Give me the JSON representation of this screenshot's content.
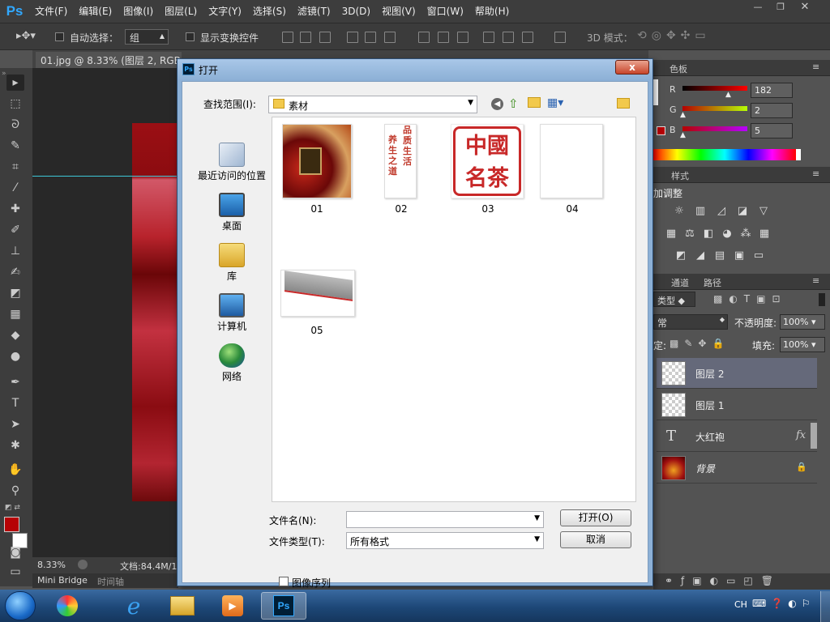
{
  "app": {
    "logo": "Ps"
  },
  "menu": [
    "文件(F)",
    "编辑(E)",
    "图像(I)",
    "图层(L)",
    "文字(Y)",
    "选择(S)",
    "滤镜(T)",
    "3D(D)",
    "视图(V)",
    "窗口(W)",
    "帮助(H)"
  ],
  "options": {
    "auto_select_label": "自动选择：",
    "auto_select_value": "组",
    "show_transform_label": "显示变换控件",
    "mode_3d_label": "3D 模式："
  },
  "document": {
    "tab_title": "01.jpg @ 8.33% (图层 2, RGB/8) *",
    "zoom": "8.33%",
    "doc_size": "文档:84.4M/1"
  },
  "bottom_tabs": [
    "Mini Bridge",
    "时间轴"
  ],
  "color_panel": {
    "tabs": [
      "色板"
    ],
    "r_label": "R",
    "g_label": "G",
    "b_label": "B",
    "r": "182",
    "g": "2",
    "b": "5",
    "fg_color": "#b60205",
    "bg_color": "#ffffff"
  },
  "adjust_panel": {
    "tabs": [
      "样式"
    ],
    "title": "加调整"
  },
  "layers_panel": {
    "tabs": [
      "通道",
      "路径"
    ],
    "kind_label": "类型",
    "blend_mode": "常",
    "opacity_label": "不透明度:",
    "opacity": "100%",
    "fill_label": "填充:",
    "fill": "100%",
    "lock_label": "定:"
  },
  "layers": [
    {
      "name": "图层 2",
      "selected": true
    },
    {
      "name": "图层 1",
      "selected": false
    },
    {
      "name": "大红袍",
      "type": "text",
      "fx": "fx"
    },
    {
      "name": "背景",
      "locked": true
    }
  ],
  "dialog": {
    "title": "打开",
    "title_icon": "Ps",
    "close": "x",
    "look_in_label": "查找范围(I):",
    "look_in_value": "素材",
    "places": [
      {
        "label": "最近访问的位置",
        "icon": "recent-places-icon"
      },
      {
        "label": "桌面",
        "icon": "desktop-icon"
      },
      {
        "label": "库",
        "icon": "libraries-icon"
      },
      {
        "label": "计算机",
        "icon": "computer-icon"
      },
      {
        "label": "网络",
        "icon": "network-icon"
      }
    ],
    "files": [
      {
        "name": "01",
        "kind": "photo"
      },
      {
        "name": "02",
        "kind": "text-vertical",
        "text": [
          "品质生活",
          "养生之道"
        ]
      },
      {
        "name": "03",
        "kind": "seal",
        "text": "中國名茶"
      },
      {
        "name": "04",
        "kind": "blank"
      },
      {
        "name": "05",
        "kind": "banner"
      }
    ],
    "filename_label": "文件名(N):",
    "filename_value": "",
    "filetype_label": "文件类型(T):",
    "filetype_value": "所有格式",
    "open_button": "打开(O)",
    "cancel_button": "取消",
    "image_sequence_label": "图像序列"
  },
  "taskbar": {
    "lang": "CH"
  }
}
